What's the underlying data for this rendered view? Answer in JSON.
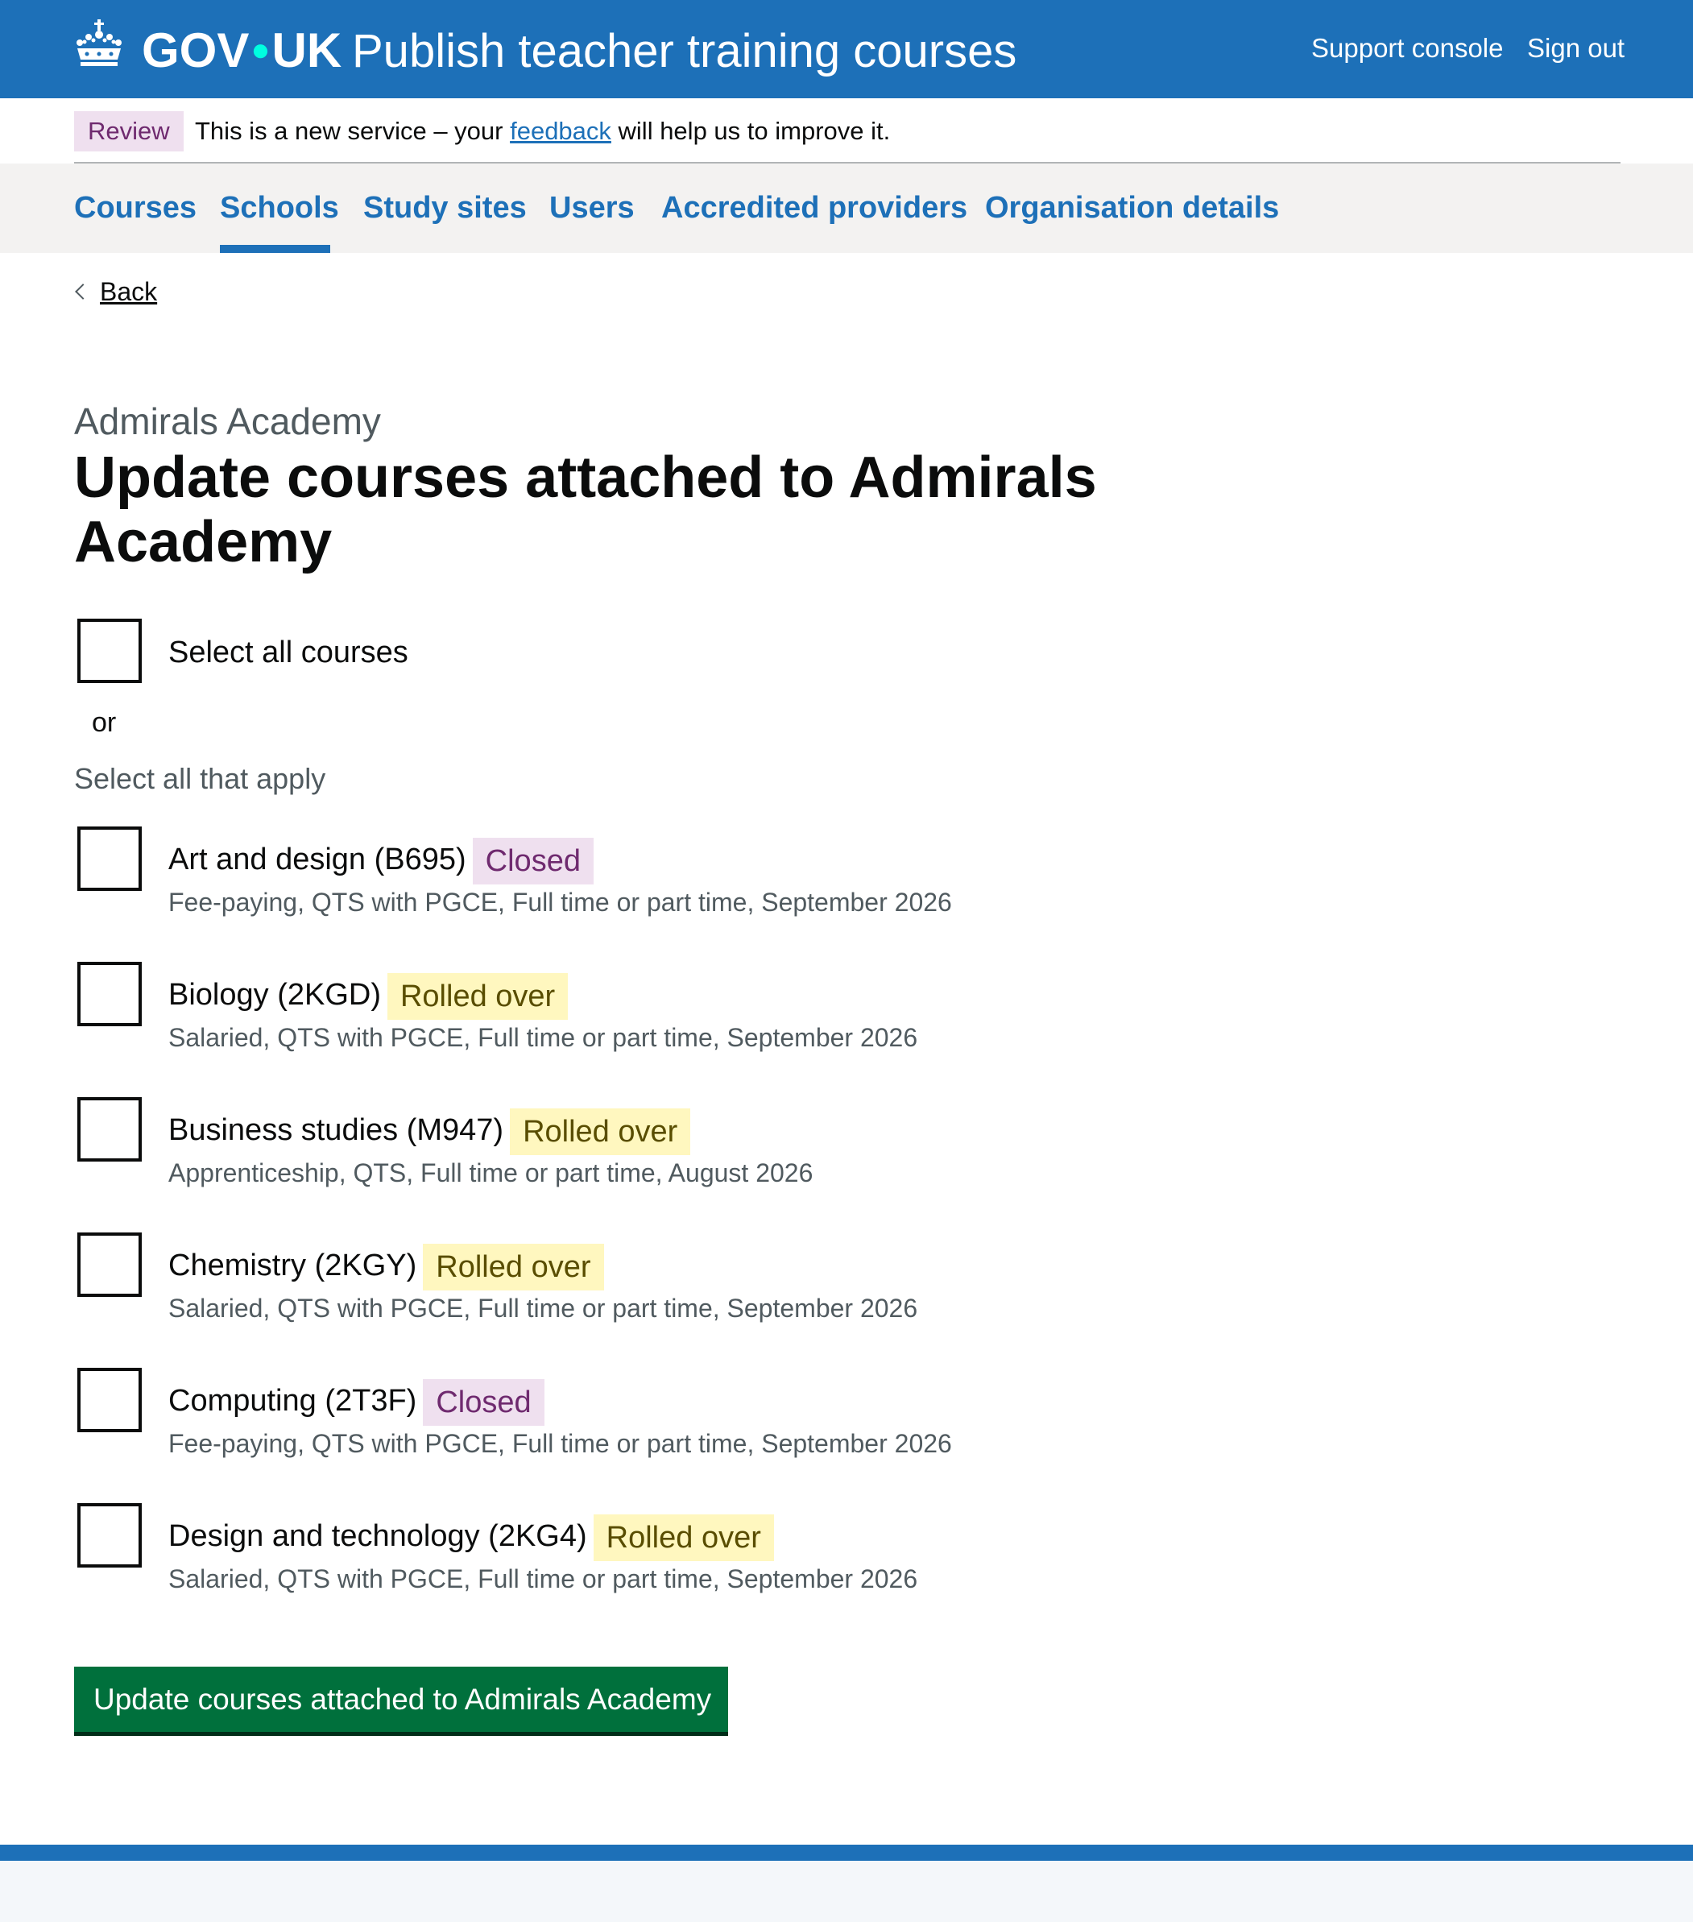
{
  "header": {
    "brand": "GOV",
    "brand_suffix": "UK",
    "service_name": "Publish teacher training courses",
    "links": {
      "support": "Support console",
      "signout": "Sign out"
    }
  },
  "phase_banner": {
    "tag": "Review",
    "text_before": "This is a new service – your ",
    "link": "feedback",
    "text_after": " will help us to improve it."
  },
  "nav": {
    "items": [
      "Courses",
      "Schools",
      "Study sites",
      "Users",
      "Accredited providers",
      "Organisation details"
    ],
    "active": "Schools"
  },
  "back_link": "Back",
  "page": {
    "caption": "Admirals Academy",
    "title": "Update courses attached to Admirals Academy"
  },
  "select_all": {
    "label": "Select all courses",
    "checked": false
  },
  "or_text": "or",
  "select_hint": "Select all that apply",
  "courses": [
    {
      "name": "Art and design (B695)",
      "status": "Closed",
      "details": "Fee-paying, QTS with PGCE, Full time or part time, September 2026",
      "checked": false
    },
    {
      "name": "Biology (2KGD)",
      "status": "Rolled over",
      "details": "Salaried, QTS with PGCE, Full time or part time, September 2026",
      "checked": false
    },
    {
      "name": "Business studies (M947)",
      "status": "Rolled over",
      "details": "Apprenticeship, QTS, Full time or part time, August 2026",
      "checked": false
    },
    {
      "name": "Chemistry (2KGY)",
      "status": "Rolled over",
      "details": "Salaried, QTS with PGCE, Full time or part time, September 2026",
      "checked": false
    },
    {
      "name": "Computing (2T3F)",
      "status": "Closed",
      "details": "Fee-paying, QTS with PGCE, Full time or part time, September 2026",
      "checked": false
    },
    {
      "name": "Design and technology (2KG4)",
      "status": "Rolled over",
      "details": "Salaried, QTS with PGCE, Full time or part time, September 2026",
      "checked": false
    }
  ],
  "submit_button": "Update courses attached to Admirals Academy",
  "colors": {
    "brand_blue": "#1d70b8",
    "button_green": "#00703c",
    "tag_closed_bg": "#efe0ef",
    "tag_rolled_bg": "#fff7bf"
  }
}
